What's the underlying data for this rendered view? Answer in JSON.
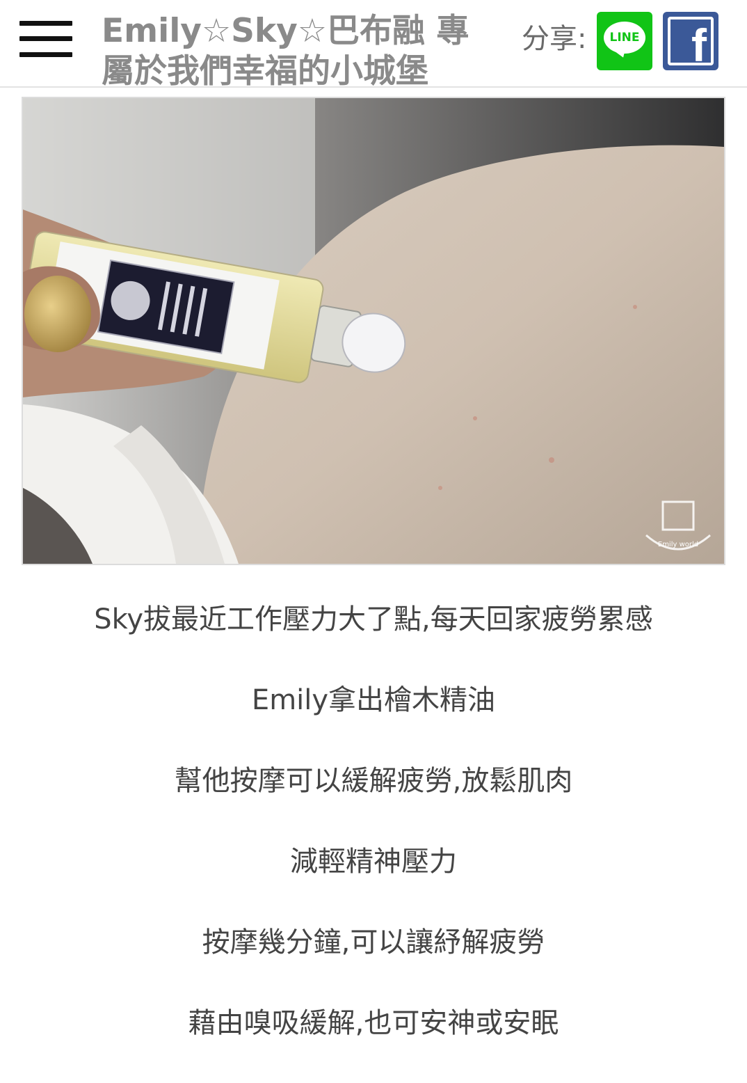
{
  "header": {
    "menu_icon": "hamburger-menu-icon",
    "site_title": "Emily☆Sky☆巴布融 專屬於我們幸福的小城堡",
    "share_label": "分享:",
    "share_buttons": [
      {
        "name": "line",
        "label": "LINE",
        "color": "#11c416"
      },
      {
        "name": "facebook",
        "label": "f",
        "color": "#3b5998"
      }
    ]
  },
  "article": {
    "photo": {
      "watermark_label": "Emily world"
    },
    "paragraphs": [
      "Sky拔最近工作壓力大了點,每天回家疲勞累感",
      "Emily拿出檜木精油",
      "幫他按摩可以緩解疲勞,放鬆肌肉",
      "減輕精神壓力",
      "按摩幾分鐘,可以讓紓解疲勞",
      "藉由嗅吸緩解,也可安神或安眠"
    ]
  },
  "colors": {
    "title_gray": "#8a8a8a",
    "body_text": "#444444",
    "line_green": "#11c416",
    "facebook_blue": "#3b5998"
  }
}
